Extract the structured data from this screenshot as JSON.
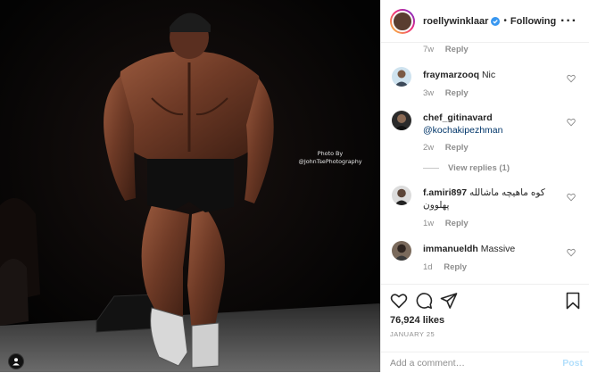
{
  "photo": {
    "credit_line1": "Photo By",
    "credit_line2": "@JohnTsePhotography"
  },
  "header": {
    "username": "roellywinklaar",
    "separator": "•",
    "follow_status": "Following"
  },
  "top_meta": {
    "time": "7w",
    "reply": "Reply"
  },
  "comments": [
    {
      "username": "fraymarzooq",
      "text": "Nic",
      "time": "3w",
      "reply": "Reply"
    },
    {
      "username": "chef_gitinavard",
      "text": "@kochakipezhman",
      "time": "2w",
      "reply": "Reply",
      "view_replies": "View replies (1)"
    },
    {
      "username": "f.amiri897",
      "text": "کوه ماهیچه ماشالله پهلوون",
      "time": "1w",
      "reply": "Reply"
    },
    {
      "username": "immanueldh",
      "text": "Massive",
      "time": "1d",
      "reply": "Reply"
    }
  ],
  "actions": {
    "likes": "76,924 likes",
    "date": "JANUARY 25"
  },
  "add_comment": {
    "placeholder": "Add a comment…",
    "post_label": "Post"
  },
  "colors": {
    "link": "#003569",
    "verified": "#3897f0",
    "post_disabled": "#b2dffc",
    "muted": "#8e8e8e"
  },
  "icons": [
    "verified-icon",
    "more-options-icon",
    "heart-icon",
    "comment-icon",
    "share-icon",
    "bookmark-icon",
    "user-tag-icon"
  ]
}
